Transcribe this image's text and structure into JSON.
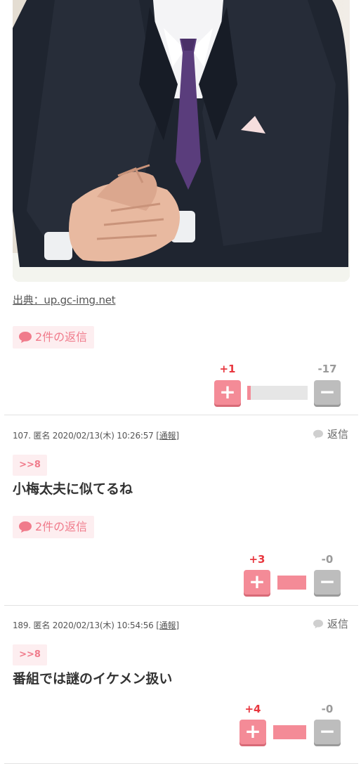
{
  "source_link": "出典：up.gc-img.net",
  "comments": [
    {
      "reply_count_label": "2件の返信",
      "plus_label": "+1",
      "minus_label": "-17",
      "plus_share": 0.06
    },
    {
      "number_name": "107. 匿名",
      "datetime": "2020/02/13(木) 10:26:57",
      "report_label": "[通報]",
      "reply_label": "返信",
      "anchor": ">>8",
      "text": "小梅太夫に似てるね",
      "reply_count_label": "2件の返信",
      "plus_label": "+3",
      "minus_label": "-0",
      "plus_share": 1.0
    },
    {
      "number_name": "189. 匿名",
      "datetime": "2020/02/13(木) 10:54:56",
      "report_label": "[通報]",
      "reply_label": "返信",
      "anchor": ">>8",
      "text": "番組では謎のイケメン扱い",
      "plus_label": "+4",
      "minus_label": "-0",
      "plus_share": 1.0
    }
  ],
  "icons": {
    "plus": "+",
    "minus": "−",
    "speech": "speech-bubble-icon"
  },
  "colors": {
    "accent_pink": "#f48b97",
    "plus_red": "#e8373f",
    "minus_gray": "#9a9a9a"
  }
}
